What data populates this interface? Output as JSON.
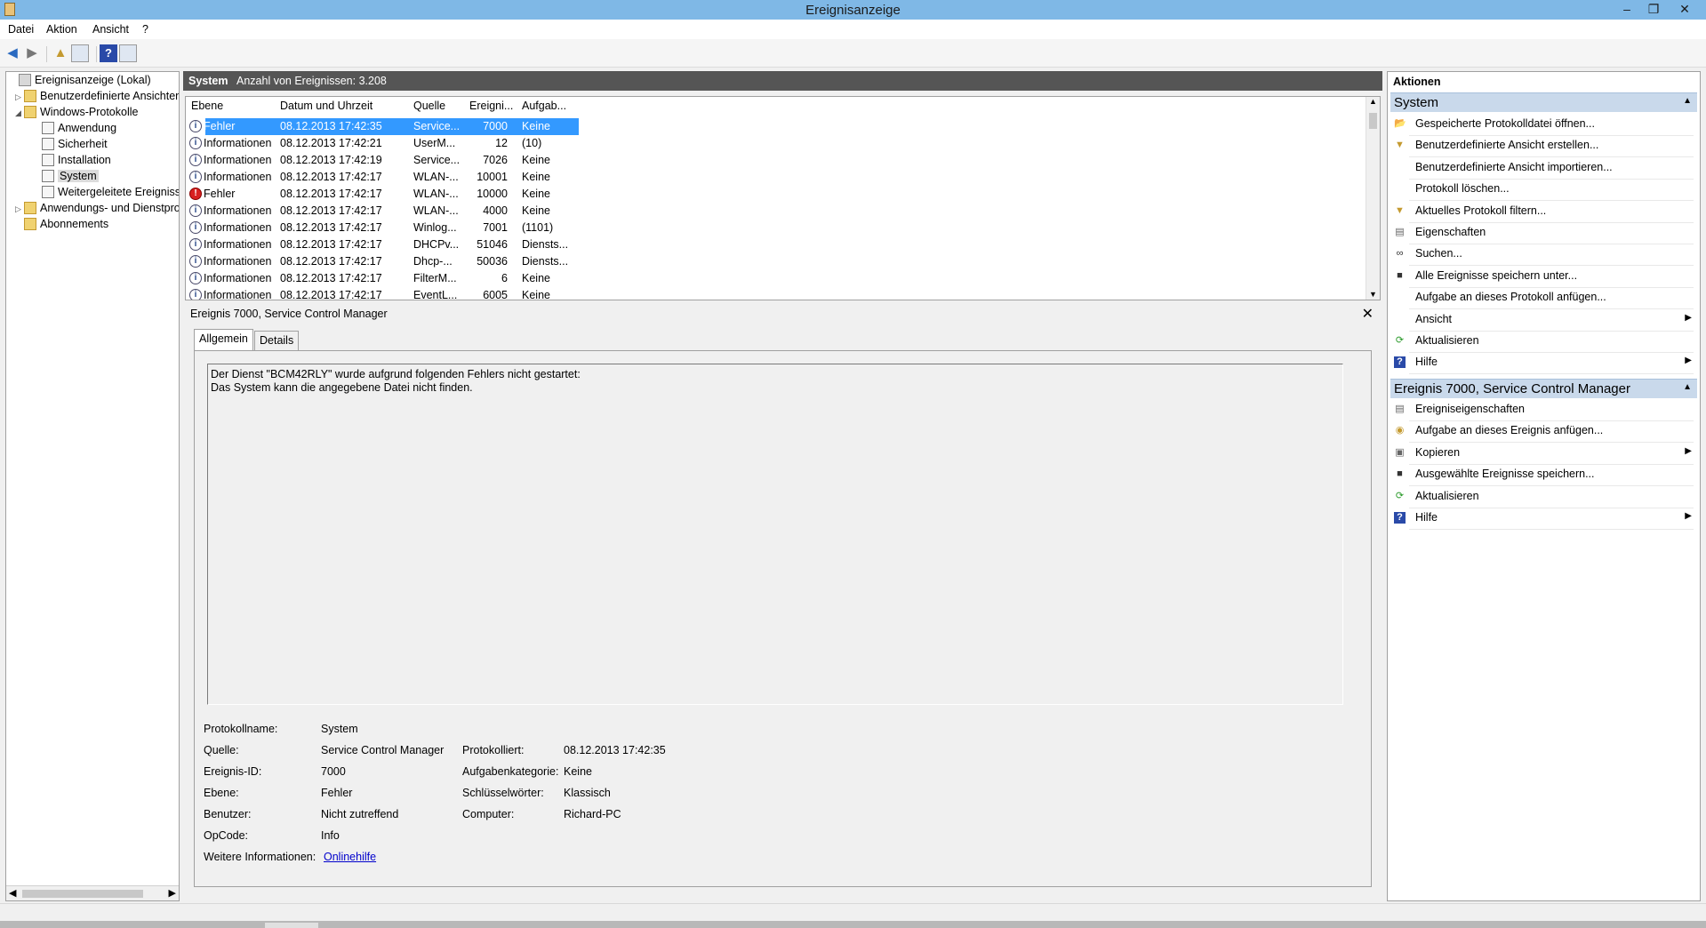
{
  "window": {
    "title": "Ereignisanzeige",
    "minimize": "–",
    "restore": "❐",
    "close": "✕"
  },
  "menu": [
    "Datei",
    "Aktion",
    "Ansicht",
    "?"
  ],
  "tree": {
    "items": [
      {
        "label": "Ereignisanzeige (Lokal)",
        "expander": "",
        "icon": "root"
      },
      {
        "label": "Benutzerdefinierte Ansichten",
        "expander": "▷",
        "icon": "folder"
      },
      {
        "label": "Windows-Protokolle",
        "expander": "◢",
        "icon": "folder"
      },
      {
        "label": "Anwendung",
        "expander": "",
        "icon": "log"
      },
      {
        "label": "Sicherheit",
        "expander": "",
        "icon": "log"
      },
      {
        "label": "Installation",
        "expander": "",
        "icon": "log"
      },
      {
        "label": "System",
        "expander": "",
        "icon": "log"
      },
      {
        "label": "Weitergeleitete Ereignisse",
        "expander": "",
        "icon": "log"
      },
      {
        "label": "Anwendungs- und Dienstprotokolle",
        "expander": "▷",
        "icon": "folder"
      },
      {
        "label": "Abonnements",
        "expander": "",
        "icon": "folder"
      }
    ]
  },
  "center": {
    "log_name": "System",
    "count_label": "Anzahl von Ereignissen: 3.208"
  },
  "event_list": {
    "columns": [
      "Ebene",
      "Datum und Uhrzeit",
      "Quelle",
      "Ereigni...",
      "Aufgab..."
    ],
    "rows": [
      {
        "level": "Fehler",
        "date": "08.12.2013 17:42:35",
        "source": "Service...",
        "id": "7000",
        "task": "Keine",
        "icon": "info"
      },
      {
        "level": "Informationen",
        "date": "08.12.2013 17:42:21",
        "source": "UserM...",
        "id": "12",
        "task": "(10)",
        "icon": "info"
      },
      {
        "level": "Informationen",
        "date": "08.12.2013 17:42:19",
        "source": "Service...",
        "id": "7026",
        "task": "Keine",
        "icon": "info"
      },
      {
        "level": "Informationen",
        "date": "08.12.2013 17:42:17",
        "source": "WLAN-...",
        "id": "10001",
        "task": "Keine",
        "icon": "info"
      },
      {
        "level": "Fehler",
        "date": "08.12.2013 17:42:17",
        "source": "WLAN-...",
        "id": "10000",
        "task": "Keine",
        "icon": "error"
      },
      {
        "level": "Informationen",
        "date": "08.12.2013 17:42:17",
        "source": "WLAN-...",
        "id": "4000",
        "task": "Keine",
        "icon": "info"
      },
      {
        "level": "Informationen",
        "date": "08.12.2013 17:42:17",
        "source": "Winlog...",
        "id": "7001",
        "task": "(1101)",
        "icon": "info"
      },
      {
        "level": "Informationen",
        "date": "08.12.2013 17:42:17",
        "source": "DHCPv...",
        "id": "51046",
        "task": "Diensts...",
        "icon": "info"
      },
      {
        "level": "Informationen",
        "date": "08.12.2013 17:42:17",
        "source": "Dhcp-...",
        "id": "50036",
        "task": "Diensts...",
        "icon": "info"
      },
      {
        "level": "Informationen",
        "date": "08.12.2013 17:42:17",
        "source": "FilterM...",
        "id": "6",
        "task": "Keine",
        "icon": "info"
      },
      {
        "level": "Informationen",
        "date": "08.12.2013 17:42:17",
        "source": "EventL...",
        "id": "6005",
        "task": "Keine",
        "icon": "info"
      }
    ]
  },
  "detail": {
    "title": "Ereignis 7000, Service Control Manager",
    "tabs": [
      "Allgemein",
      "Details"
    ],
    "message": "Der Dienst \"BCM42RLY\" wurde aufgrund folgenden Fehlers nicht gestartet:\nDas System kann die angegebene Datei nicht finden.",
    "props": {
      "protokollname_label": "Protokollname:",
      "protokollname": "System",
      "quelle_label": "Quelle:",
      "quelle": "Service Control Manager",
      "protokolliert_label": "Protokolliert:",
      "protokolliert": "08.12.2013 17:42:35",
      "ereignis_id_label": "Ereignis-ID:",
      "ereignis_id": "7000",
      "aufgabenkategorie_label": "Aufgabenkategorie:",
      "aufgabenkategorie": "Keine",
      "ebene_label": "Ebene:",
      "ebene": "Fehler",
      "schluesselwoerter_label": "Schlüsselwörter:",
      "schluesselwoerter": "Klassisch",
      "benutzer_label": "Benutzer:",
      "benutzer": "Nicht zutreffend",
      "computer_label": "Computer:",
      "computer": "Richard-PC",
      "opcode_label": "OpCode:",
      "opcode": "Info",
      "weitere_label": "Weitere Informationen:",
      "weitere_link": "Onlinehilfe"
    }
  },
  "actions": {
    "header": "Aktionen",
    "section1": {
      "title": "System",
      "items": [
        {
          "label": "Gespeicherte Protokolldatei öffnen...",
          "icon": "open-folder-icon",
          "submenu": false
        },
        {
          "label": "Benutzerdefinierte Ansicht erstellen...",
          "icon": "filter-icon",
          "submenu": false
        },
        {
          "label": "Benutzerdefinierte Ansicht importieren...",
          "icon": "",
          "submenu": false
        },
        {
          "label": "Protokoll löschen...",
          "icon": "",
          "submenu": false
        },
        {
          "label": "Aktuelles Protokoll filtern...",
          "icon": "filter-icon",
          "submenu": false
        },
        {
          "label": "Eigenschaften",
          "icon": "properties-icon",
          "submenu": false
        },
        {
          "label": "Suchen...",
          "icon": "binoculars-icon",
          "submenu": false
        },
        {
          "label": "Alle Ereignisse speichern unter...",
          "icon": "save-icon",
          "submenu": false
        },
        {
          "label": "Aufgabe an dieses Protokoll anfügen...",
          "icon": "",
          "submenu": false
        },
        {
          "label": "Ansicht",
          "icon": "",
          "submenu": true
        },
        {
          "label": "Aktualisieren",
          "icon": "refresh-icon",
          "submenu": false
        },
        {
          "label": "Hilfe",
          "icon": "help-icon",
          "submenu": true
        }
      ]
    },
    "section2": {
      "title": "Ereignis 7000, Service Control Manager",
      "items": [
        {
          "label": "Ereigniseigenschaften",
          "icon": "properties-icon",
          "submenu": false
        },
        {
          "label": "Aufgabe an dieses Ereignis anfügen...",
          "icon": "task-icon",
          "submenu": false
        },
        {
          "label": "Kopieren",
          "icon": "copy-icon",
          "submenu": true
        },
        {
          "label": "Ausgewählte Ereignisse speichern...",
          "icon": "save-icon",
          "submenu": false
        },
        {
          "label": "Aktualisieren",
          "icon": "refresh-icon",
          "submenu": false
        },
        {
          "label": "Hilfe",
          "icon": "help-icon",
          "submenu": true
        }
      ]
    }
  },
  "colors": {
    "selection": "#3399ff",
    "section_header": "#c9d9eb",
    "title_bar": "#7fb8e6",
    "center_header": "#555555",
    "link": "#0000cc"
  }
}
